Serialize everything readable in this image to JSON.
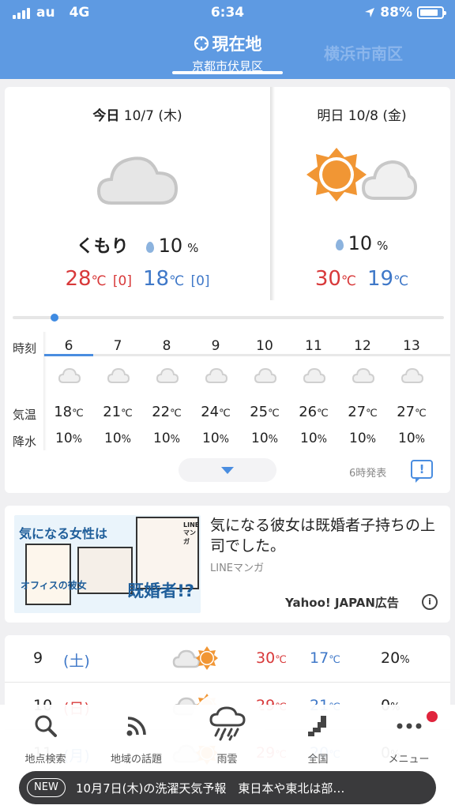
{
  "status": {
    "carrier": "au",
    "network": "4G",
    "time": "6:34",
    "battery": "88%"
  },
  "header": {
    "current_title": "現在地",
    "current_sub": "京都市伏見区",
    "other_location": "横浜市南区"
  },
  "today": {
    "label": "今日",
    "date": "10/7 (木)",
    "condition": "くもり",
    "pop": "10",
    "pop_unit": "%",
    "high": "28",
    "high_diff": "[0]",
    "low": "18",
    "low_diff": "[0]",
    "unit": "℃"
  },
  "tomorrow": {
    "label": "明日",
    "date": "10/8 (金)",
    "pop": "10",
    "pop_unit": "%",
    "high": "30",
    "low": "19",
    "unit": "℃"
  },
  "hourly": {
    "labels": {
      "hour": "時刻",
      "temp": "気温",
      "rain": "降水"
    },
    "hours": [
      {
        "h": "6",
        "t": "18",
        "r": "10"
      },
      {
        "h": "7",
        "t": "21",
        "r": "10"
      },
      {
        "h": "8",
        "t": "22",
        "r": "10"
      },
      {
        "h": "9",
        "t": "24",
        "r": "10"
      },
      {
        "h": "10",
        "t": "25",
        "r": "10"
      },
      {
        "h": "11",
        "t": "26",
        "r": "10"
      },
      {
        "h": "12",
        "t": "27",
        "r": "10"
      },
      {
        "h": "13",
        "t": "27",
        "r": "10"
      }
    ],
    "unit_temp": "℃",
    "unit_rain": "%",
    "issued": "6時発表"
  },
  "ad": {
    "image_text_1": "気になる女性は",
    "image_text_2": "既婚者!?",
    "image_logo": "オフィスの彼女",
    "image_brand": "LINEマンガ",
    "title": "気になる彼女は既婚者子持ちの上司でした。",
    "source": "LINEマンガ",
    "label": "Yahoo! JAPAN広告",
    "info": "i"
  },
  "weekly": [
    {
      "day": "9",
      "weekday": "(土)",
      "high": "30",
      "low": "17",
      "pop": "20"
    },
    {
      "day": "10",
      "weekday": "(日)",
      "high": "29",
      "low": "21",
      "pop": "0"
    },
    {
      "day": "11",
      "weekday": "(月)",
      "high": "29",
      "low": "20",
      "pop": "0"
    }
  ],
  "weekly_units": {
    "temp": "℃",
    "pop": "%"
  },
  "tabs": [
    {
      "label": "地点検索",
      "icon": "search-icon"
    },
    {
      "label": "地域の話題",
      "icon": "feed-icon"
    },
    {
      "label": "雨雲",
      "icon": "rain-cloud-icon"
    },
    {
      "label": "全国",
      "icon": "map-icon"
    },
    {
      "label": "メニュー",
      "icon": "more-icon"
    }
  ],
  "news": {
    "badge": "NEW",
    "text": "10月7日(木)の洗濯天気予報　東日本や東北は部…"
  },
  "colors": {
    "header": "#5e9ae2",
    "high": "#d8393a",
    "low": "#3f78c8",
    "accent": "#4a8de0"
  }
}
